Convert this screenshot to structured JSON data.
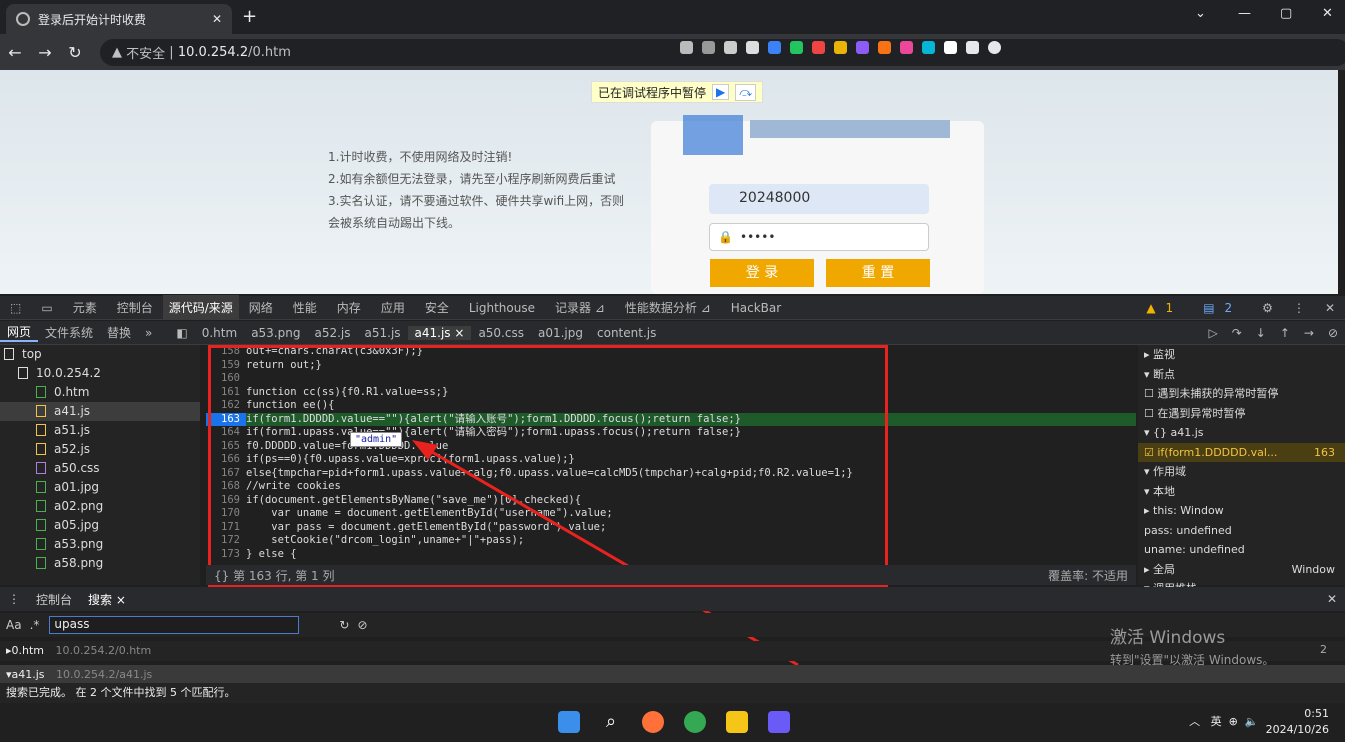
{
  "browser": {
    "tab_title": "登录后开始计时收费",
    "address": {
      "insecure": "不安全",
      "host": "10.0.254.2",
      "path": "/0.htm"
    }
  },
  "page": {
    "pause_text": "已在调试程序中暂停",
    "notice": [
      "1.计时收费，不使用网络及时注销!",
      "2.如有余额但无法登录，请先至小程序刷新网费后重试",
      "3.实名认证，请不要通过软件、硬件共享wifi上网，否则",
      "会被系统自动踢出下线。"
    ],
    "username": "20248000",
    "password_mask": "•••••",
    "login_label": "登 录",
    "reset_label": "重 置"
  },
  "devtools": {
    "tabs": [
      "元素",
      "控制台",
      "源代码/来源",
      "网络",
      "性能",
      "内存",
      "应用",
      "安全",
      "Lighthouse",
      "记录器 ⊿",
      "性能数据分析 ⊿",
      "HackBar"
    ],
    "active_tab": "源代码/来源",
    "issues": "1",
    "messages": "2",
    "nav_tabs": [
      "网页",
      "文件系统",
      "替换",
      "»"
    ],
    "file_tabs": [
      "0.htm",
      "a53.png",
      "a52.js",
      "a51.js",
      "a41.js ×",
      "a50.css",
      "a01.jpg",
      "content.js"
    ],
    "tree": [
      {
        "label": "top",
        "t": "f"
      },
      {
        "label": "10.0.254.2",
        "t": "c"
      },
      {
        "label": "0.htm",
        "t": "g"
      },
      {
        "label": "a41.js",
        "t": "y"
      },
      {
        "label": "a51.js",
        "t": "y"
      },
      {
        "label": "a52.js",
        "t": "y"
      },
      {
        "label": "a50.css",
        "t": "p"
      },
      {
        "label": "a01.jpg",
        "t": "g"
      },
      {
        "label": "a02.png",
        "t": "g"
      },
      {
        "label": "a05.jpg",
        "t": "g"
      },
      {
        "label": "a53.png",
        "t": "g"
      },
      {
        "label": "a58.png",
        "t": "g"
      }
    ],
    "code": [
      {
        "n": "158",
        "c": "out+=chars.charAt(c3&0x3F);}"
      },
      {
        "n": "159",
        "c": "return out;}"
      },
      {
        "n": "160",
        "c": ""
      },
      {
        "n": "161",
        "c": "function cc(ss){f0.R1.value=ss;}"
      },
      {
        "n": "162",
        "c": "function ee(){"
      },
      {
        "n": "163",
        "c": "if(form1.DDDDD.value==\"\"){alert(\"请输入账号\");form1.DDDDD.focus();return false;}",
        "hl": true
      },
      {
        "n": "164",
        "c": "if(form1.upass.value==\"\"){alert(\"请输入密码\");form1.upass.focus();return false;}"
      },
      {
        "n": "165",
        "c": "f0.DDDDD.value=form1.DDDDD.value"
      },
      {
        "n": "166",
        "c": "if(ps==0){f0.upass.value=xproc1(form1.upass.value);}"
      },
      {
        "n": "167",
        "c": "else{tmpchar=pid+form1.upass.value+calg;f0.upass.value=calcMD5(tmpchar)+calg+pid;f0.R2.value=1;}"
      },
      {
        "n": "168",
        "c": "//write cookies"
      },
      {
        "n": "169",
        "c": "if(document.getElementsByName(\"save_me\")[0].checked){"
      },
      {
        "n": "170",
        "c": "    var uname = document.getElementById(\"username\").value;"
      },
      {
        "n": "171",
        "c": "    var pass = document.getElementById(\"password\").value;"
      },
      {
        "n": "172",
        "c": "    setCookie(\"drcom_login\",uname+\"|\"+pass);"
      },
      {
        "n": "173",
        "c": "} else {"
      }
    ],
    "tooltip": "\"admin\"",
    "status_left": "{} 第 163 行, 第 1 列",
    "status_right": "覆盖率: 不适用",
    "debugger": [
      {
        "l": "▸ 监视"
      },
      {
        "l": "▾ 断点"
      },
      {
        "l": "☐ 遇到未捕获的异常时暂停"
      },
      {
        "l": "☐ 在遇到异常时暂停"
      },
      {
        "l": "▾ {} a41.js"
      },
      {
        "l": "☑ if(form1.DDDDD.val...",
        "r": "163"
      },
      {
        "l": "▾ 作用域"
      },
      {
        "l": "▾ 本地"
      },
      {
        "l": " ▸ this: Window"
      },
      {
        "l": "   pass: undefined"
      },
      {
        "l": "   uname: undefined"
      },
      {
        "l": "▸ 全局",
        "r": "Window"
      },
      {
        "l": "▾ 调用堆栈"
      }
    ],
    "drawer_tabs": [
      "控制台",
      "搜索 ×"
    ],
    "search_value": "upass",
    "results": [
      {
        "file": "▸0.htm",
        "path": "10.0.254.2/0.htm",
        "count": "2"
      },
      {
        "file": "▾a41.js",
        "path": "10.0.254.2/a41.js",
        "count": ""
      }
    ],
    "search_summary": "搜索已完成。 在 2 个文件中找到 5 个匹配行。"
  },
  "watermark": {
    "title": "激活 Windows",
    "sub": "转到\"设置\"以激活 Windows。"
  },
  "tray": {
    "ime": "英",
    "time": "0:51",
    "date": "2024/10/26"
  },
  "colors": {
    "highlight": "#1e5a2a",
    "annotation": "#e8231f"
  }
}
